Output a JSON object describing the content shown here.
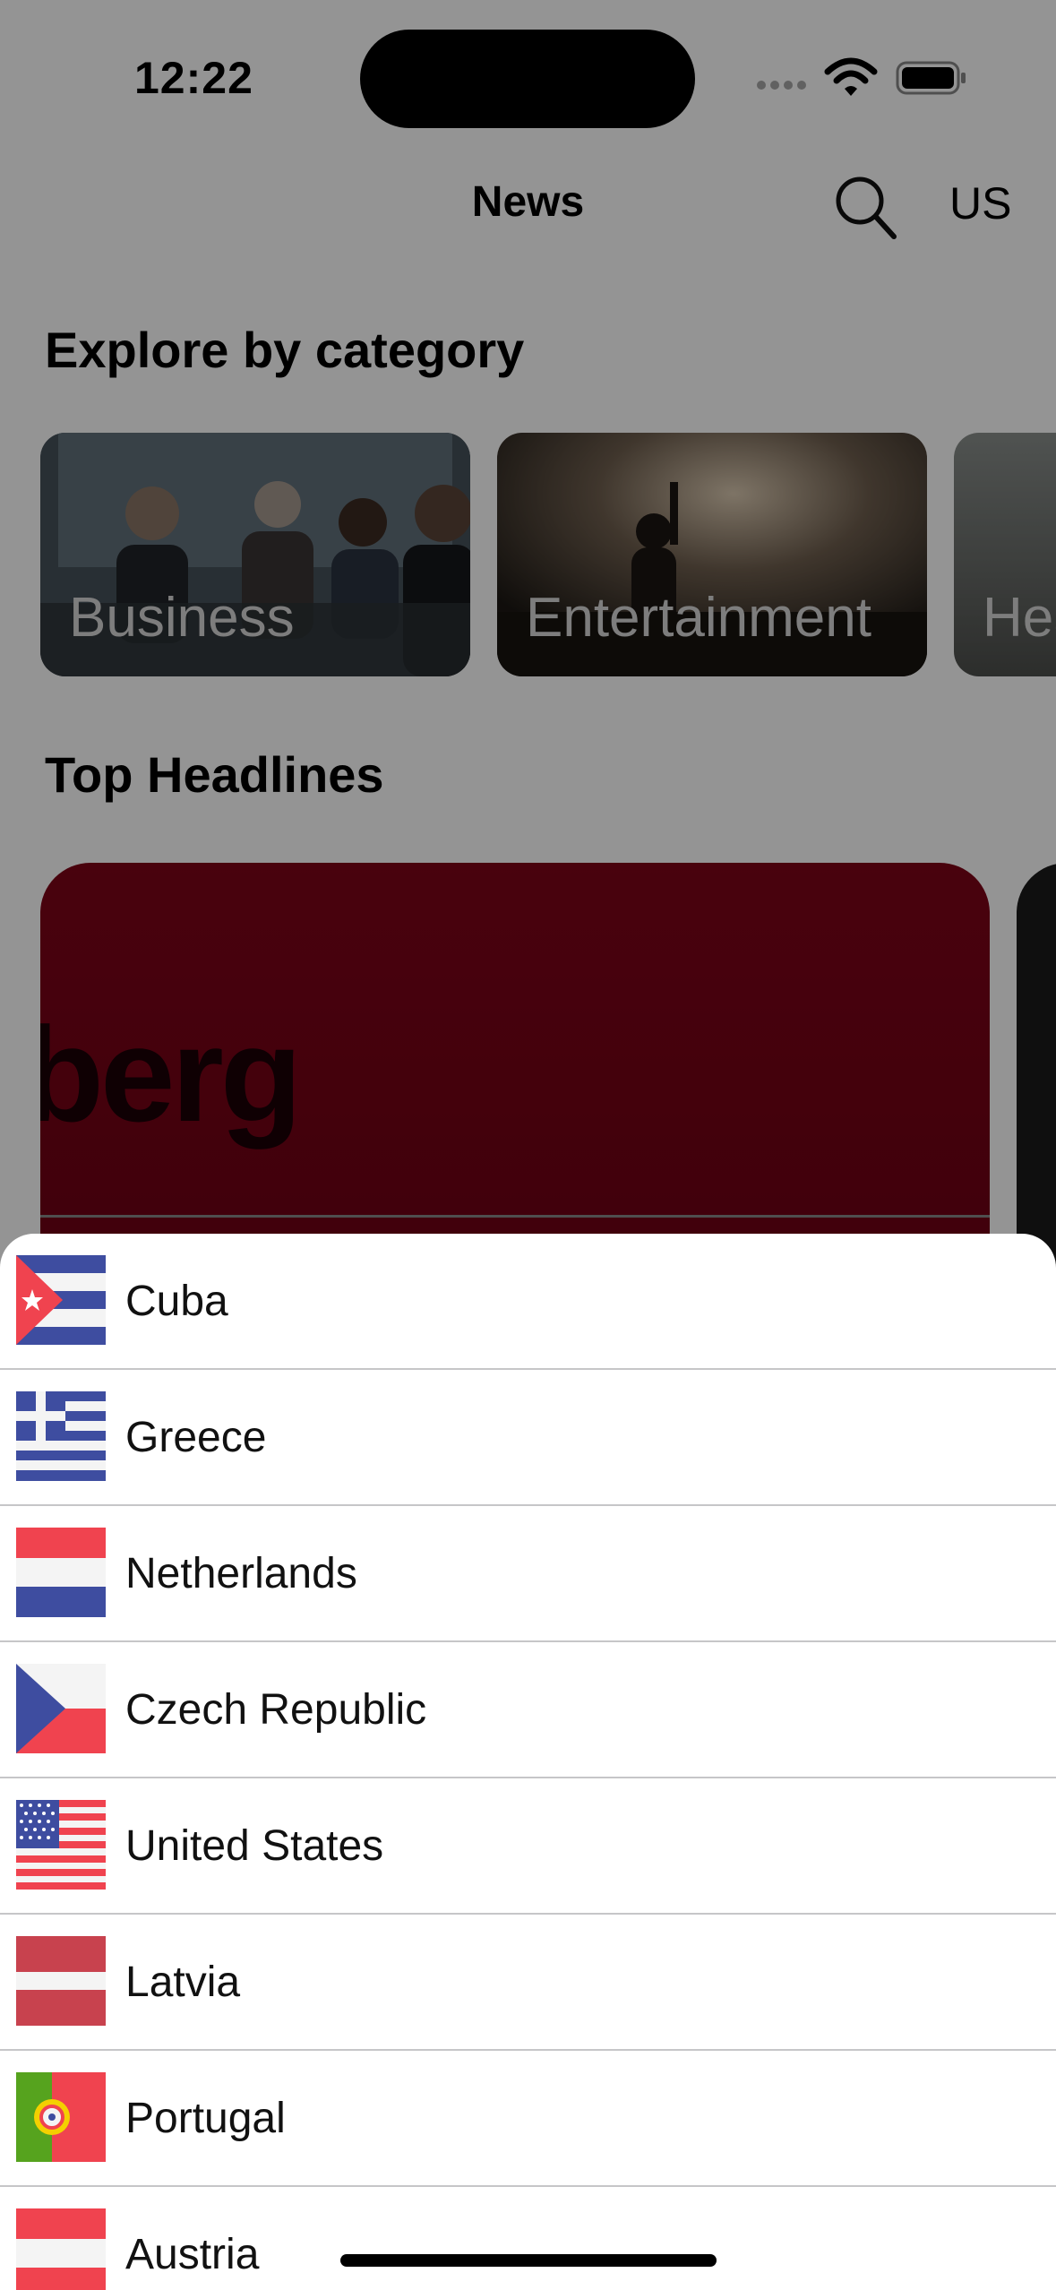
{
  "status_bar": {
    "time": "12:22"
  },
  "nav": {
    "title": "News",
    "region": "US"
  },
  "explore": {
    "title": "Explore by category",
    "categories": [
      {
        "label": "Business"
      },
      {
        "label": "Entertainment"
      },
      {
        "label": "Hea"
      }
    ]
  },
  "headlines": {
    "title": "Top Headlines",
    "source_fragment": "mberg"
  },
  "countries": [
    {
      "name": "Cuba",
      "flag": "cuba-flag-icon"
    },
    {
      "name": "Greece",
      "flag": "greece-flag-icon"
    },
    {
      "name": "Netherlands",
      "flag": "netherlands-flag-icon"
    },
    {
      "name": "Czech Republic",
      "flag": "czech-flag-icon"
    },
    {
      "name": "United States",
      "flag": "usa-flag-icon"
    },
    {
      "name": "Latvia",
      "flag": "latvia-flag-icon"
    },
    {
      "name": "Portugal",
      "flag": "portugal-flag-icon"
    },
    {
      "name": "Austria",
      "flag": "austria-flag-icon"
    }
  ],
  "colors": {
    "overlay": "#000000",
    "accent_red": "#7e0418",
    "flag_blue": "#3e4da0",
    "flag_red": "#f0434f"
  }
}
